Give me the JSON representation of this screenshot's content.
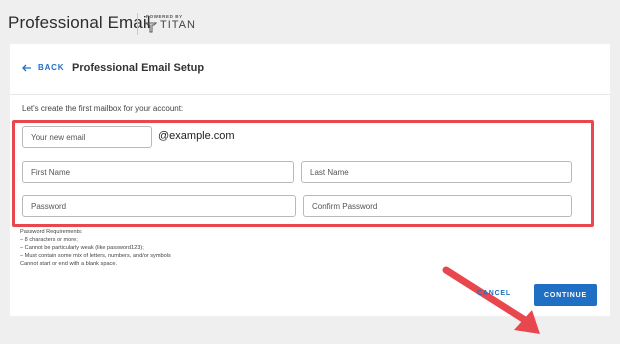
{
  "header": {
    "title": "Professional Email",
    "powered_by": "POWERED BY",
    "partner": "TITAN"
  },
  "card": {
    "back_label": "BACK",
    "title": "Professional Email Setup",
    "intro": "Let's create the first mailbox for your account:"
  },
  "form": {
    "email_placeholder": "Your new email",
    "domain": "@example.com",
    "first_name_placeholder": "First Name",
    "last_name_placeholder": "Last Name",
    "password_placeholder": "Password",
    "confirm_password_placeholder": "Confirm Password"
  },
  "requirements": [
    "Password Requirements:",
    "– 8 characters or more;",
    "– Cannot be particularly weak (like password123);",
    "– Must contain some mix of letters, numbers, and/or symbols",
    "Cannot start or end with a blank space."
  ],
  "actions": {
    "cancel_label": "CANCEL",
    "continue_label": "CONTINUE"
  },
  "colors": {
    "accent": "#1f6fc5",
    "annotation": "#e8484d"
  }
}
